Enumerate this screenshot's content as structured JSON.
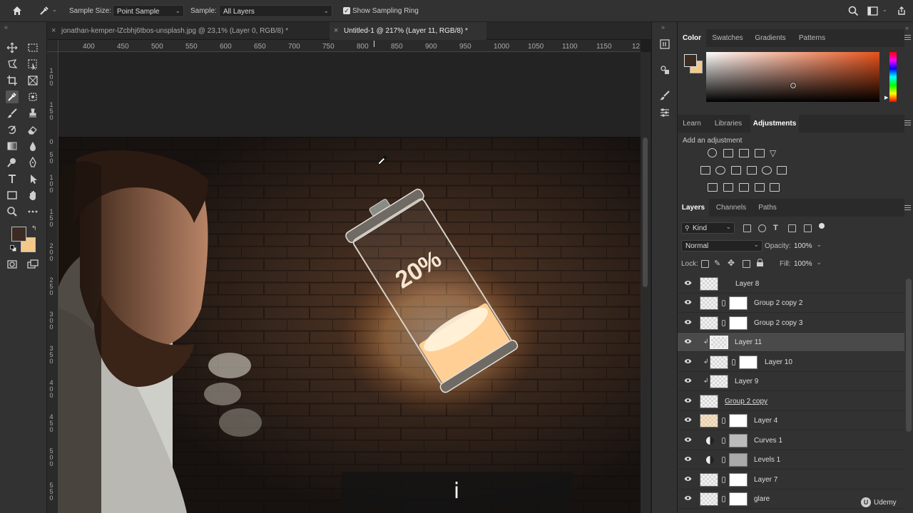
{
  "options_bar": {
    "sample_size_label": "Sample Size:",
    "sample_size_value": "Point Sample",
    "sample_label": "Sample:",
    "sample_value": "All Layers",
    "show_ring_label": "Show Sampling Ring",
    "show_ring_checked": true
  },
  "doc_tabs": [
    {
      "label": "jonathan-kemper-lZcbhj6tbos-unsplash.jpg @ 23,1% (Layer 0, RGB/8) *",
      "active": false
    },
    {
      "label": "Untitled-1 @ 217% (Layer 11, RGB/8) *",
      "active": true
    }
  ],
  "ruler": {
    "h_ticks": [
      "400",
      "450",
      "500",
      "550",
      "600",
      "650",
      "700",
      "750",
      "800",
      "850",
      "900",
      "950",
      "1000",
      "1050",
      "1100",
      "1150",
      "12"
    ],
    "v_ticks": [
      "1\n0\n0",
      "1\n5\n0",
      "0",
      "5\n0",
      "1\n0\n0",
      "1\n5\n0",
      "2\n0\n0",
      "2\n5\n0",
      "3\n0\n0",
      "3\n5\n0",
      "4\n0\n0",
      "4\n5\n0",
      "5\n0\n0",
      "5\n5\n0"
    ]
  },
  "canvas": {
    "battery_text": "20%",
    "caption": "i"
  },
  "color_panel": {
    "tabs": [
      "Color",
      "Swatches",
      "Gradients",
      "Patterns"
    ],
    "active": "Color",
    "foreground": "#3b2b22",
    "background": "#f3c98a"
  },
  "adjust_panel": {
    "tabs": [
      "Learn",
      "Libraries",
      "Adjustments"
    ],
    "active": "Adjustments",
    "add_label": "Add an adjustment"
  },
  "layers_panel": {
    "tabs": [
      "Layers",
      "Channels",
      "Paths"
    ],
    "active": "Layers",
    "filter_kind": "Kind",
    "blend_mode": "Normal",
    "opacity_label": "Opacity:",
    "opacity_value": "100%",
    "lock_label": "Lock:",
    "fill_label": "Fill:",
    "fill_value": "100%",
    "layers": [
      {
        "name": "Layer 8",
        "type": "pixel"
      },
      {
        "name": "Group 2 copy 2",
        "type": "smart-mask"
      },
      {
        "name": "Group 2 copy 3",
        "type": "smart-mask"
      },
      {
        "name": "Layer 11",
        "type": "clipped",
        "selected": true
      },
      {
        "name": "Layer 10",
        "type": "clipped-mask"
      },
      {
        "name": "Layer 9",
        "type": "clipped"
      },
      {
        "name": "Group 2 copy",
        "type": "smart"
      },
      {
        "name": "Layer 4",
        "type": "pixel-mask"
      },
      {
        "name": "Curves 1",
        "type": "adjustment"
      },
      {
        "name": "Levels 1",
        "type": "adjustment"
      },
      {
        "name": "Layer 7",
        "type": "pixel-mask"
      },
      {
        "name": "glare",
        "type": "pixel-mask"
      }
    ]
  },
  "watermark": "Udemy"
}
